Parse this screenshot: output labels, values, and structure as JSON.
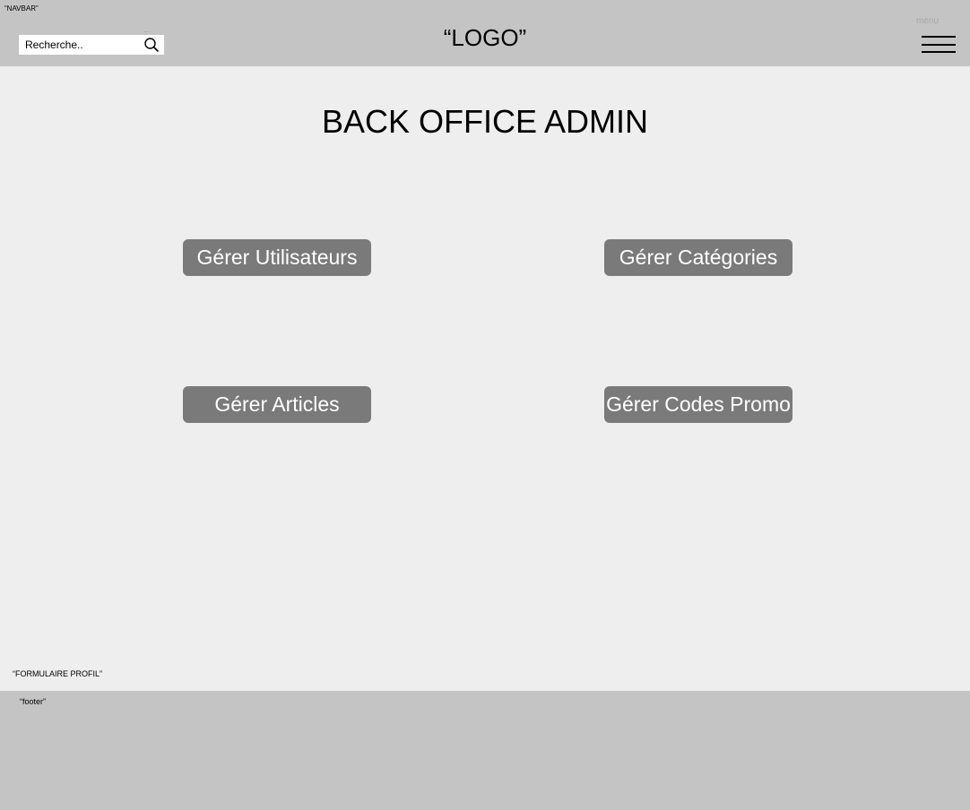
{
  "navbar": {
    "tag": "“NAVBAR”",
    "search_placeholder": "Recherche..",
    "search_dots": "...",
    "logo": "“LOGO”",
    "menu_label": "menu"
  },
  "main": {
    "title": "BACK OFFICE ADMIN",
    "buttons": {
      "users": "Gérer Utilisateurs",
      "categories": "Gérer Catégories",
      "articles": "Gérer Articles",
      "promo": "Gérer Codes Promo"
    },
    "form_tag": "“FORMULAIRE PROFIL”"
  },
  "footer": {
    "tag": "“footer”"
  },
  "icons": {
    "search": "search-icon",
    "menu": "hamburger-menu-icon"
  },
  "colors": {
    "navbar_bg": "#c4c4c4",
    "page_bg": "#eeeeee",
    "button_bg": "#7a7a7a",
    "button_text": "#ffffff"
  }
}
